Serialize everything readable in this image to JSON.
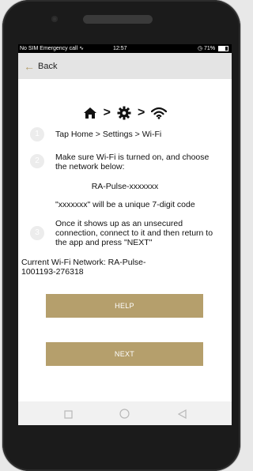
{
  "statusbar": {
    "left": "No SIM  Emergency call",
    "time": "12:57",
    "battery": "71%"
  },
  "header": {
    "back_label": "Back"
  },
  "icons": [
    "home-icon",
    "gear-icon",
    "wifi-icon",
    "back-arrow-icon"
  ],
  "steps": [
    {
      "number": "1",
      "text": "Tap Home > Settings > Wi-Fi"
    },
    {
      "number": "2",
      "text": "Make sure Wi-Fi is turned on, and choose the network below:"
    },
    {
      "number": "3",
      "text": "Once it shows up as an unsecured connection, connect to it and then return to the app and press \"NEXT\""
    }
  ],
  "network_name": "RA-Pulse-xxxxxxx",
  "code_note": "\"xxxxxxx\" will be a unique 7-digit code",
  "current_network": "Current Wi-Fi Network: RA-Pulse-1001193-276318",
  "buttons": {
    "help": "HELP",
    "next": "NEXT"
  },
  "colors": {
    "accent": "#b59f6c",
    "header_bg": "#e4e4e4"
  }
}
